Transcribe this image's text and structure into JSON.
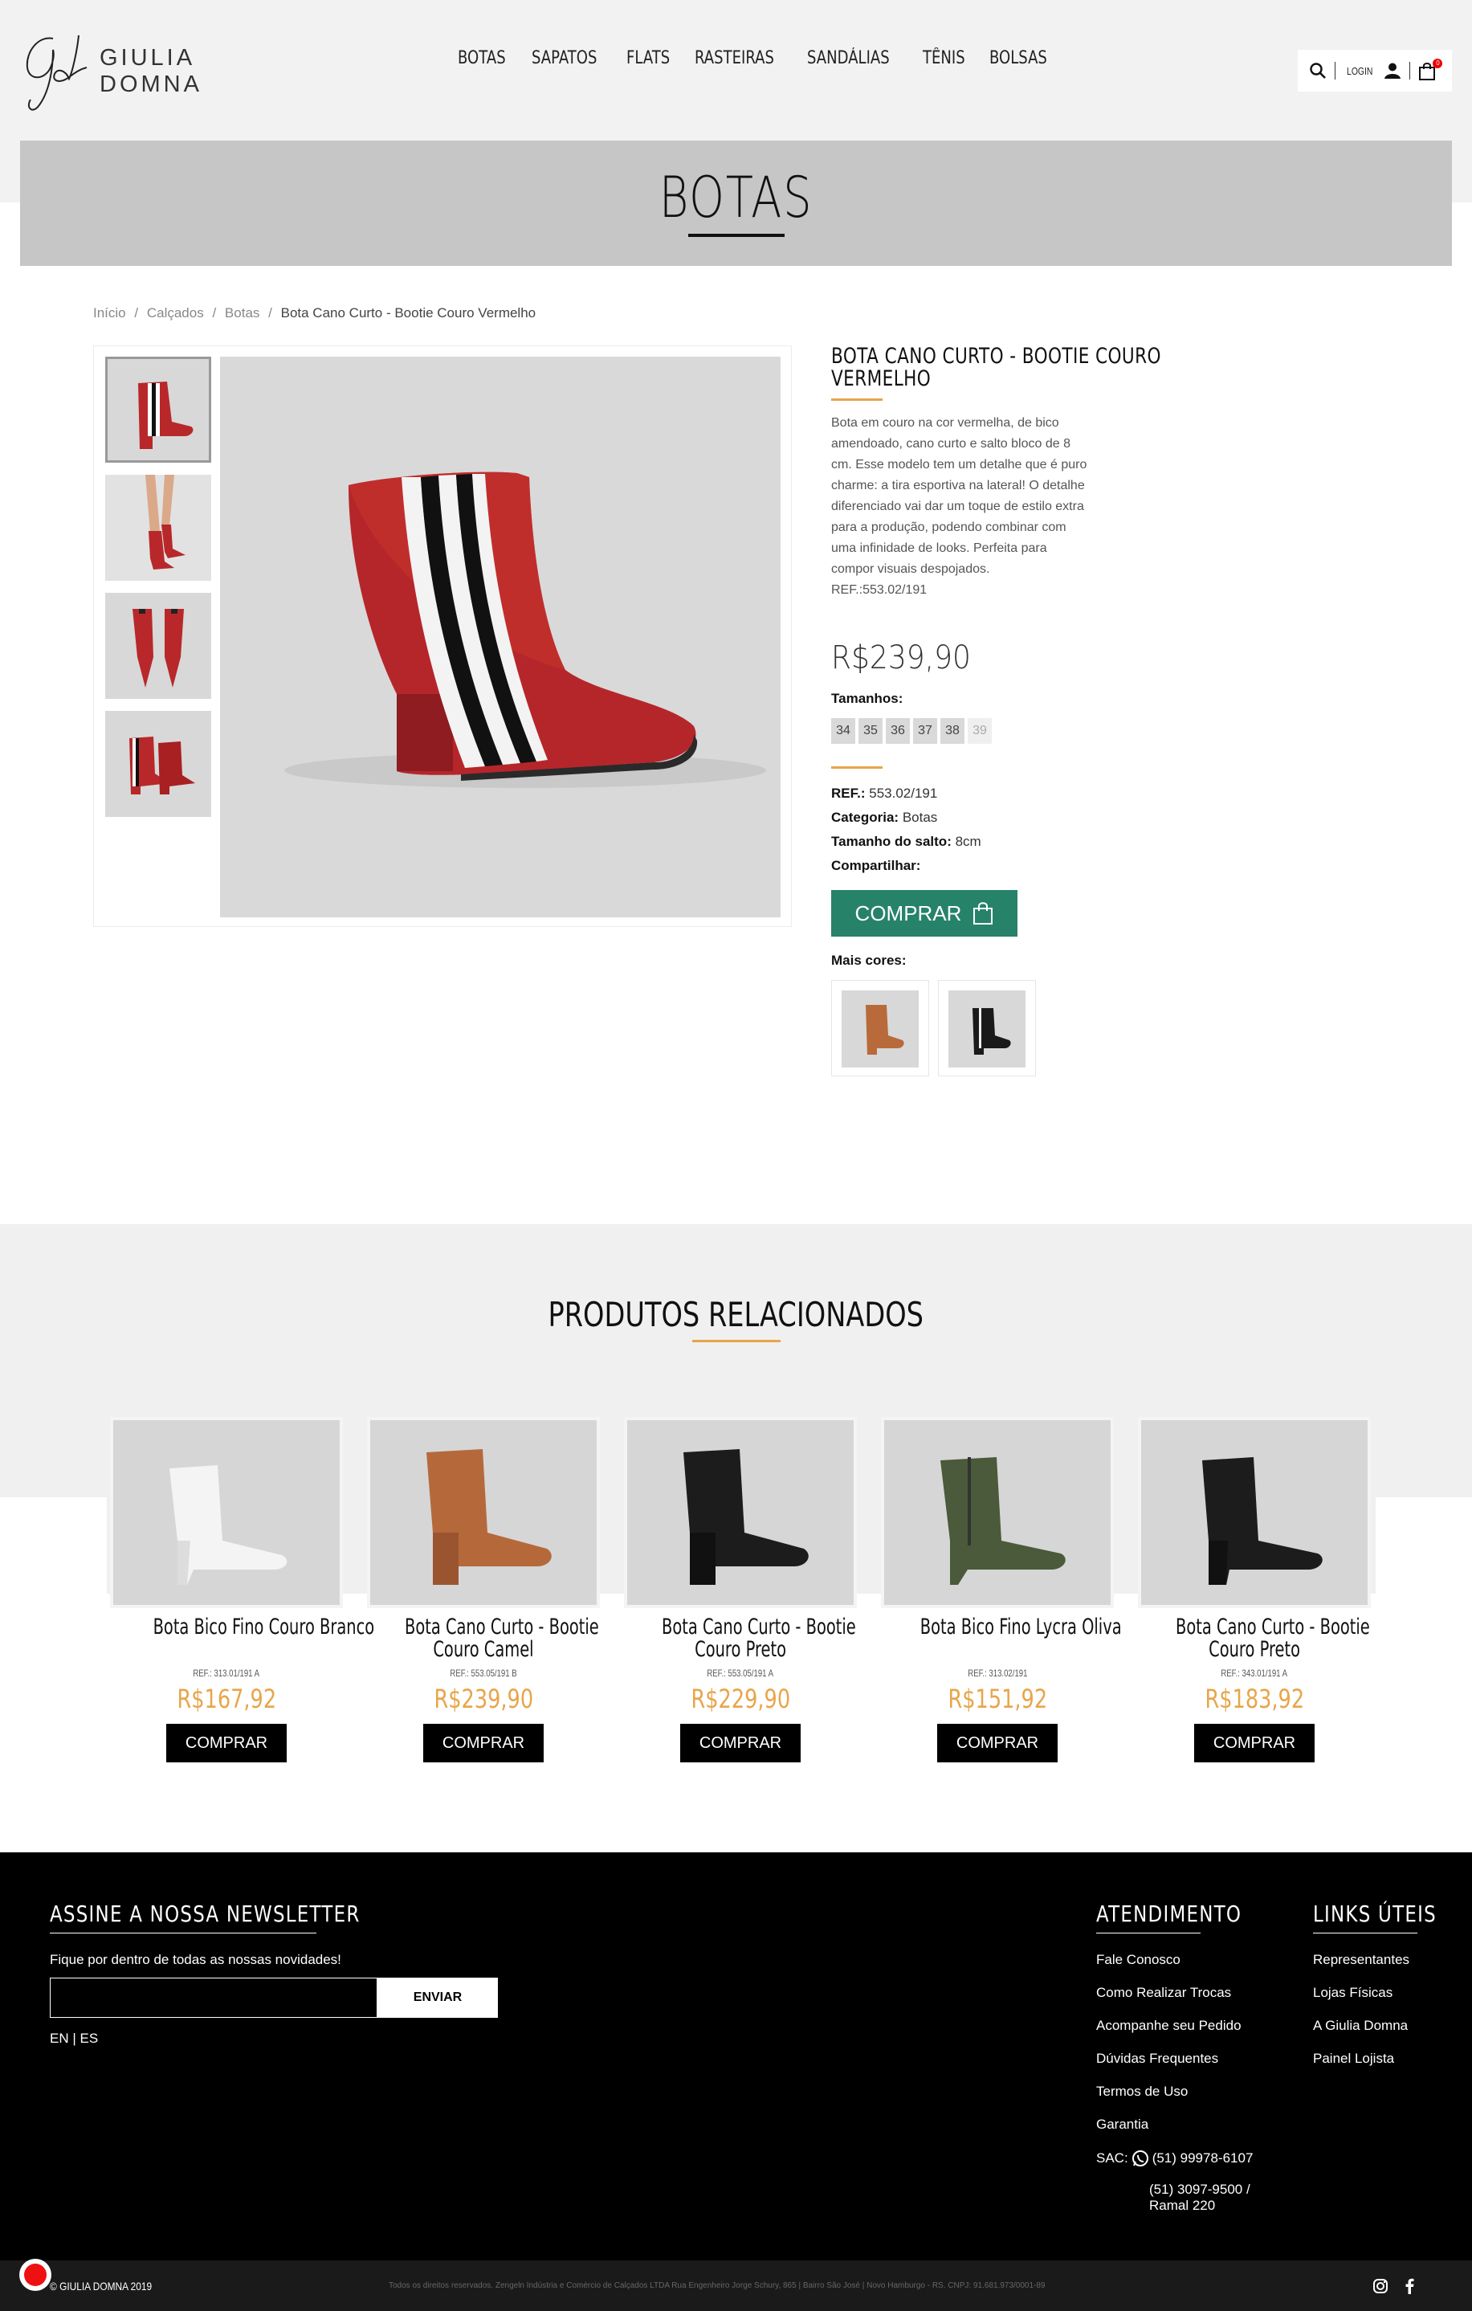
{
  "brand": {
    "name": "GIULIA DOMNA",
    "monogram": "Gd"
  },
  "nav": [
    "BOTAS",
    "SAPATOS",
    "FLATS",
    "RASTEIRAS",
    "SANDÁLIAS",
    "TÊNIS",
    "BOLSAS"
  ],
  "tools": {
    "login": "LOGIN",
    "cart_count": "0"
  },
  "hero": {
    "title": "BOTAS"
  },
  "breadcrumb": {
    "home": "Início",
    "cat": "Calçados",
    "sub": "Botas",
    "current": "Bota Cano Curto - Bootie Couro Vermelho",
    "sep": "/"
  },
  "product": {
    "title_line1": "BOTA CANO CURTO - BOOTIE COURO",
    "title_line2": "VERMELHO",
    "description": "Bota em couro na cor vermelha, de bico amendoado, cano curto e salto bloco de 8 cm. Esse modelo tem um detalhe que é puro charme: a tira esportiva na lateral! O detalhe diferenciado vai dar um toque de estilo extra para a produção, podendo combinar com uma infinidade de looks. Perfeita para compor visuais despojados. REF.:553.02/191",
    "price": "R$239,90",
    "sizes_label": "Tamanhos:",
    "sizes": [
      "34",
      "35",
      "36",
      "37",
      "38",
      "39"
    ],
    "ref_label": "REF.:",
    "ref": "553.02/191",
    "category_label": "Categoria:",
    "category": "Botas",
    "heel_label": "Tamanho do salto:",
    "heel": "8cm",
    "share_label": "Compartilhar:",
    "buy": "COMPRAR",
    "more_colors": "Mais cores:",
    "accent": "#e8a54a",
    "buy_color": "#27826a"
  },
  "related": {
    "title": "PRODUTOS RELACIONADOS",
    "items": [
      {
        "name1": "Bota Bico Fino Couro Branco",
        "name2": "",
        "ref": "REF.: 313.01/191 A",
        "price": "R$167,92",
        "buy": "COMPRAR"
      },
      {
        "name1": "Bota Cano Curto - Bootie",
        "name2": "Couro Camel",
        "ref": "REF.: 553.05/191 B",
        "price": "R$239,90",
        "buy": "COMPRAR"
      },
      {
        "name1": "Bota Cano Curto - Bootie",
        "name2": "Couro Preto",
        "ref": "REF.: 553.05/191 A",
        "price": "R$229,90",
        "buy": "COMPRAR"
      },
      {
        "name1": "Bota Bico Fino Lycra Oliva",
        "name2": "",
        "ref": "REF.: 313.02/191",
        "price": "R$151,92",
        "buy": "COMPRAR"
      },
      {
        "name1": "Bota Cano Curto - Bootie",
        "name2": "Couro Preto",
        "ref": "REF.: 343.01/191 A",
        "price": "R$183,92",
        "buy": "COMPRAR"
      }
    ]
  },
  "footer": {
    "newsletter_title": "ASSINE A NOSSA NEWSLETTER",
    "newsletter_text": "Fique por dentro de todas as nossas novidades!",
    "send": "ENVIAR",
    "lang_en": "EN",
    "lang_sep": "|",
    "lang_es": "ES",
    "service_title": "ATENDIMENTO",
    "service_links": [
      "Fale Conosco",
      "Como Realizar Trocas",
      "Acompanhe seu Pedido",
      "Dúvidas Frequentes",
      "Termos de Uso",
      "Garantia"
    ],
    "sac_label": "SAC:",
    "sac_phone": "(51) 99978-6107",
    "sac_phone2": "(51) 3097-9500 /",
    "sac_ext": "Ramal 220",
    "links_title": "LINKS ÚTEIS",
    "useful_links": [
      "Representantes",
      "Lojas Físicas",
      "A Giulia Domna",
      "Painel Lojista"
    ],
    "copyright": "© GIULIA DOMNA 2019",
    "legal": "Todos os direitos reservados. Zengeln Indústria e Comércio de Calçados LTDA Rua Engenheiro Jorge Schury, 865 | Bairro São José | Novo Hamburgo - RS. CNPJ: 91.681.973/0001-89"
  }
}
